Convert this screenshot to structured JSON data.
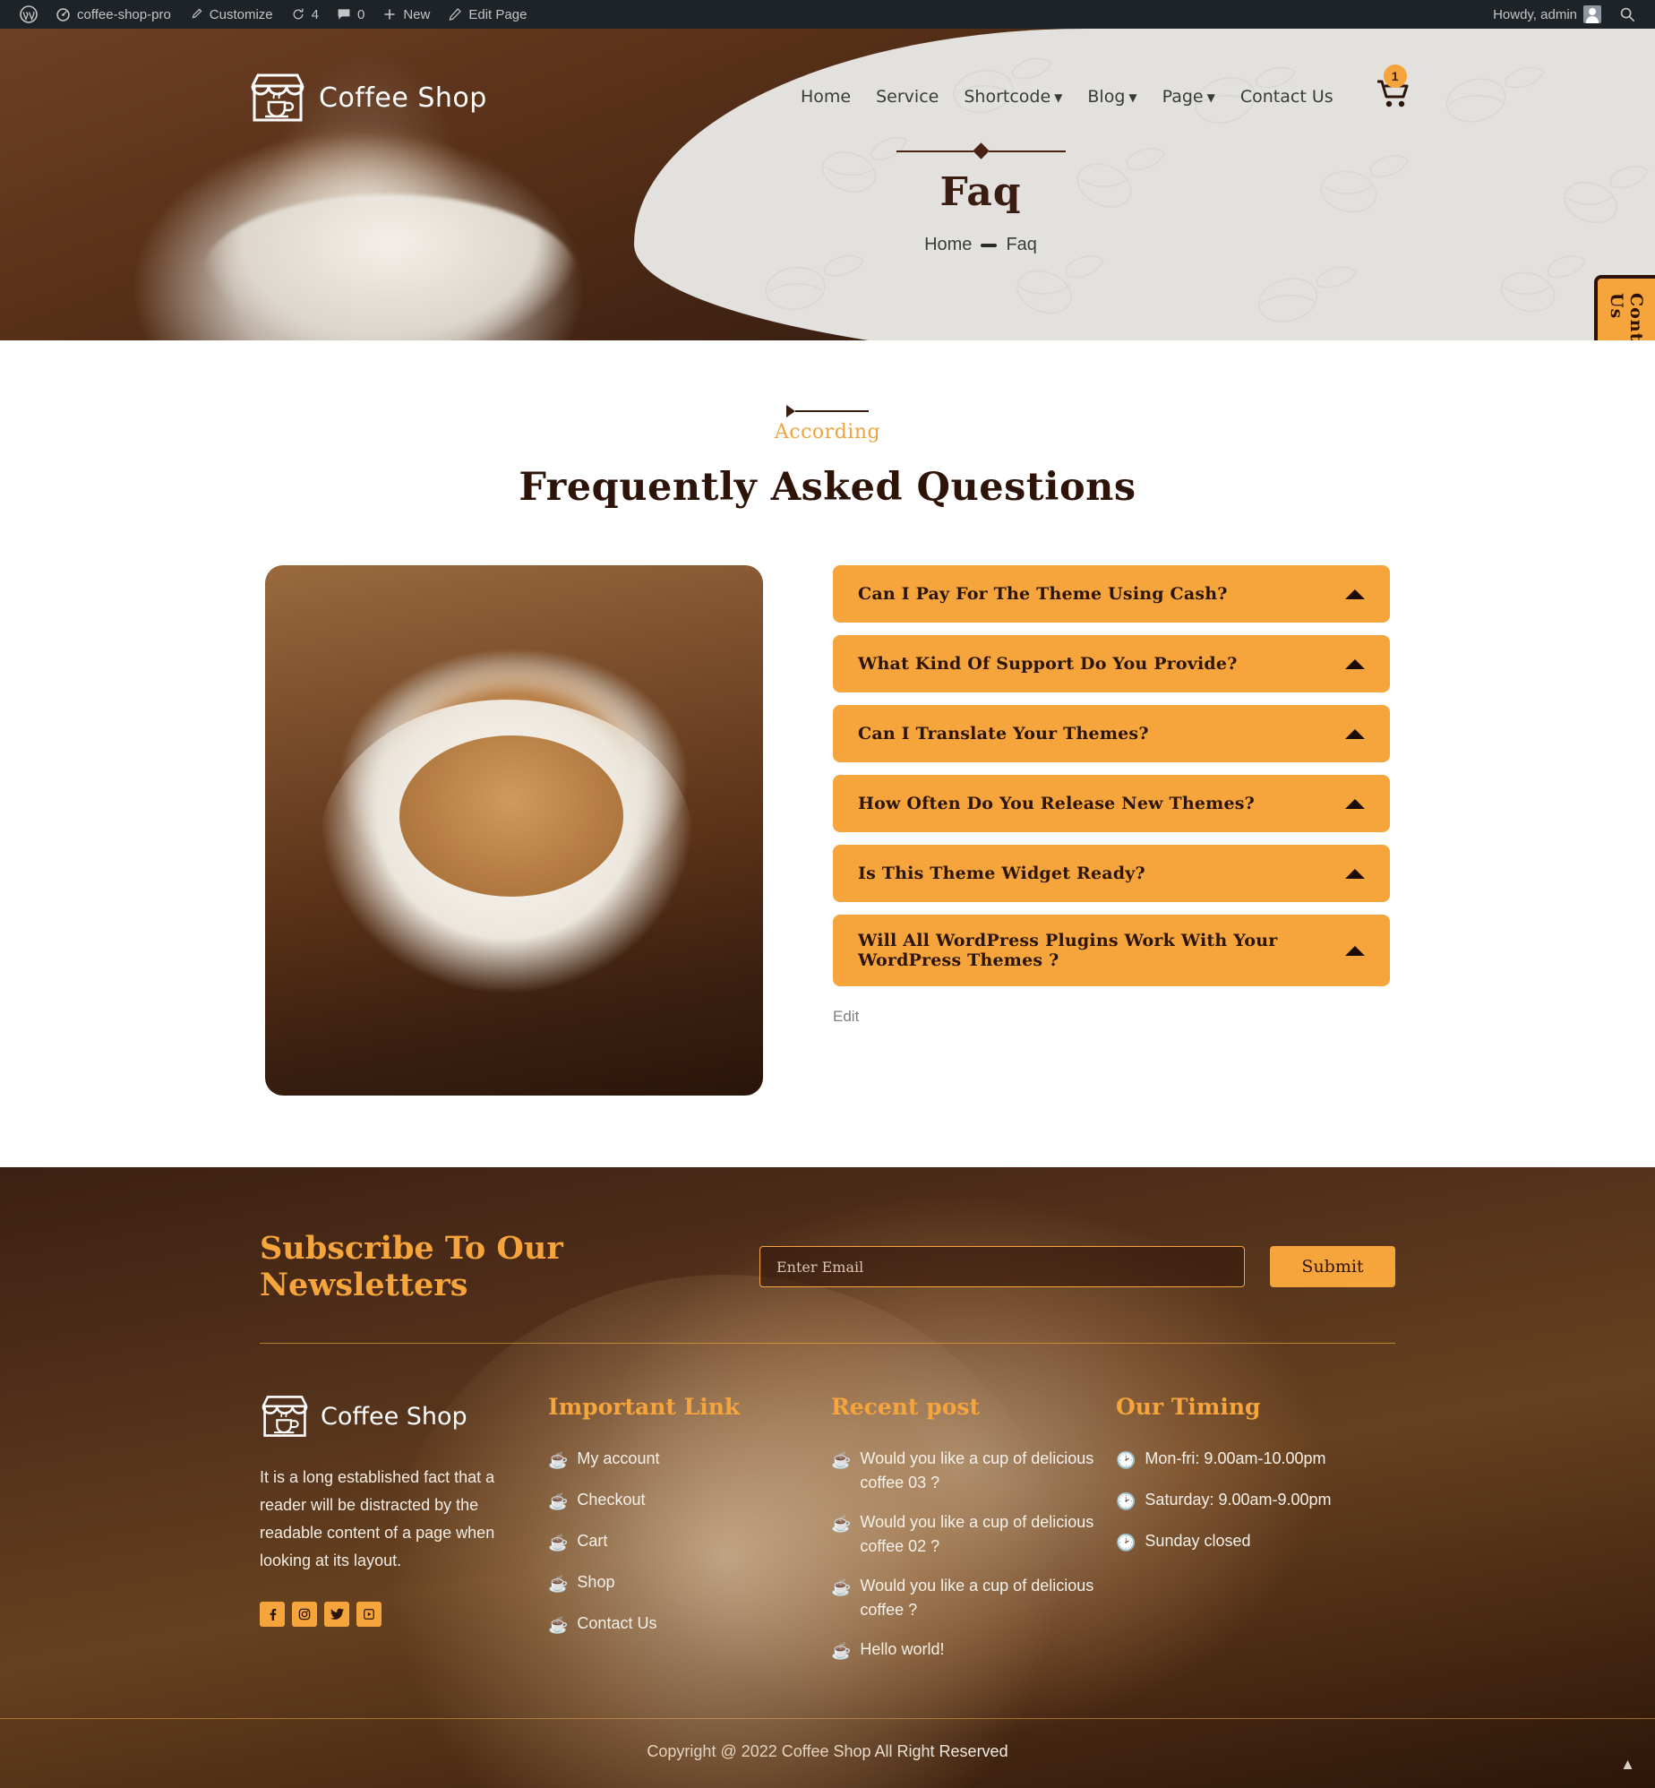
{
  "adminbar": {
    "wp_logo": "wordpress-icon",
    "site_name": "coffee-shop-pro",
    "customize": "Customize",
    "updates_count": "4",
    "comments_count": "0",
    "new": "New",
    "edit_page": "Edit Page",
    "howdy": "Howdy, admin",
    "search": "search-icon"
  },
  "header": {
    "brand": "Coffee Shop",
    "nav": [
      {
        "label": "Home",
        "caret": false
      },
      {
        "label": "Service",
        "caret": false
      },
      {
        "label": "Shortcode",
        "caret": true
      },
      {
        "label": "Blog",
        "caret": true
      },
      {
        "label": "Page",
        "caret": true
      },
      {
        "label": "Contact Us",
        "caret": false
      }
    ],
    "cart_count": "1",
    "page_title": "Faq",
    "breadcrumb_home": "Home",
    "breadcrumb_current": "Faq",
    "contact_tab": "Contact Us"
  },
  "faq": {
    "subtitle": "According",
    "title": "Frequently Asked Questions",
    "items": [
      {
        "question": "Can I Pay For The Theme Using Cash?"
      },
      {
        "question": "What Kind Of Support Do You Provide?"
      },
      {
        "question": "Can I Translate Your Themes?"
      },
      {
        "question": "How Often Do You Release New Themes?"
      },
      {
        "question": "Is This Theme Widget Ready?"
      },
      {
        "question": "Will All WordPress Plugins Work With Your WordPress Themes ?"
      }
    ],
    "edit_label": "Edit"
  },
  "newsletter": {
    "heading": "Subscribe To Our Newsletters",
    "placeholder": "Enter Email",
    "value": "",
    "submit": "Submit"
  },
  "footer": {
    "brand": "Coffee Shop",
    "about": "It is a long established fact that a reader will be distracted by the readable content of a page when looking at its layout.",
    "socials": [
      "facebook-icon",
      "instagram-icon",
      "twitter-icon",
      "youtube-icon"
    ],
    "links_title": "Important Link",
    "links": [
      "My account",
      "Checkout",
      "Cart",
      "Shop",
      "Contact Us"
    ],
    "recent_title": "Recent post",
    "recent": [
      "Would you like a cup of delicious coffee 03 ?",
      "Would you like a cup of delicious coffee 02 ?",
      "Would you like a cup of delicious coffee ?",
      "Hello world!"
    ],
    "timing_title": "Our Timing",
    "timing": [
      "Mon-fri: 9.00am-10.00pm",
      "Saturday: 9.00am-9.00pm",
      "Sunday closed"
    ],
    "copyright": "Copyright @ 2022 Coffee Shop All Right Reserved",
    "scroll_top": "scroll-top-icon"
  },
  "colors": {
    "accent": "#f5a53c",
    "dark_brown": "#2b1408",
    "panel": "#e2e1de"
  }
}
